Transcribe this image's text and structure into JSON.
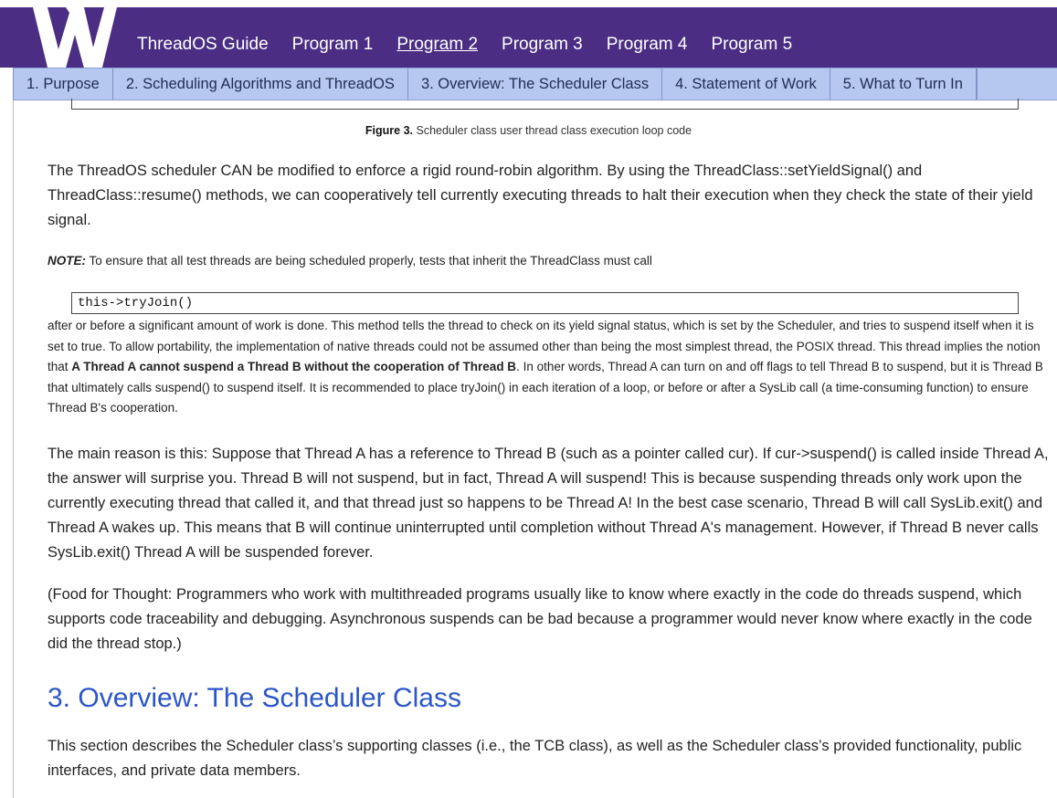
{
  "nav": {
    "items": [
      {
        "label": "ThreadOS Guide"
      },
      {
        "label": "Program 1"
      },
      {
        "label": "Program 2"
      },
      {
        "label": "Program 3"
      },
      {
        "label": "Program 4"
      },
      {
        "label": "Program 5"
      }
    ],
    "active_index": 2
  },
  "subnav": {
    "items": [
      {
        "label": "1. Purpose"
      },
      {
        "label": "2. Scheduling Algorithms and ThreadOS"
      },
      {
        "label": "3. Overview: The Scheduler Class"
      },
      {
        "label": "4. Statement of Work"
      },
      {
        "label": "5. What to Turn In"
      }
    ]
  },
  "content": {
    "figure_caption_label": "Figure 3.",
    "figure_caption_text": " Scheduler class user thread class execution loop code",
    "para1": "The ThreadOS scheduler CAN be modified to enforce a rigid round-robin algorithm. By using the ThreadClass::setYieldSignal() and ThreadClass::resume() methods, we can cooperatively tell currently executing threads to halt their execution when they check the state of their yield signal.",
    "note_label": "NOTE:",
    "note_text": " To ensure that all test threads are being scheduled properly, tests that inherit the ThreadClass must call",
    "code": "this->tryJoin()",
    "para2_a": "after or before a significant amount of work is done. This method tells the thread to check on its yield signal status, which is set by the Scheduler, and tries to suspend itself when it is set to true. To allow portability, the implementation of native threads could not be assumed other than being the most simplest thread, the POSIX thread. This thread implies the notion that ",
    "para2_bold": "A Thread A cannot suspend a Thread B without the cooperation of Thread B",
    "para2_b": ". In other words, Thread A can turn on and off flags to tell Thread B to suspend, but it is Thread B that ultimately calls suspend() to suspend itself. It is recommended to place tryJoin() in each iteration of a loop, or before or after a SysLib call (a time-consuming function) to ensure Thread B's cooperation.",
    "para3": "The main reason is this: Suppose that Thread A has a reference to Thread B (such as a pointer called cur). If cur->suspend() is called inside Thread A, the answer will surprise you. Thread B will not suspend, but in fact, Thread A will suspend! This is because suspending threads only work upon the currently executing thread that called it, and that thread just so happens to be Thread A! In the best case scenario, Thread B will call SysLib.exit() and Thread A wakes up. This means that B will continue uninterrupted until completion without Thread A's management. However, if Thread B never calls SysLib.exit() Thread A will be suspended forever.",
    "para4": "(Food for Thought: Programmers who work with multithreaded programs usually like to know where exactly in the code do threads suspend, which supports code traceability and debugging. Asynchronous suspends can be bad because a programmer would never know where exactly in the code did the thread stop.)",
    "heading": "3. Overview: The Scheduler Class",
    "para5": "This section describes the Scheduler class’s supporting classes (i.e., the TCB class), as well as the Scheduler class’s provided functionality, public interfaces, and private data members."
  },
  "colors": {
    "header_bg": "#4b2e83",
    "subnav_bg": "#b7c8f0",
    "heading": "#2b56c8"
  },
  "icons": {
    "logo": "uw-w-logo"
  }
}
